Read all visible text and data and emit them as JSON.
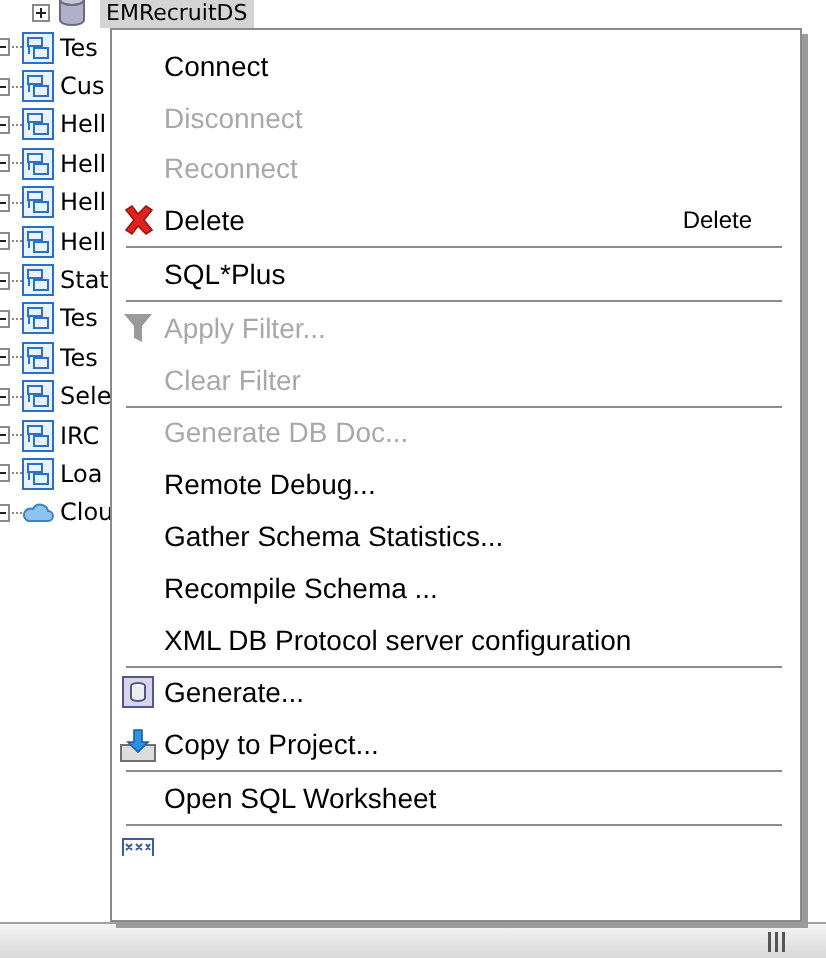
{
  "tree": {
    "root": {
      "label": "EMRecruitDS",
      "selected": true,
      "expanded": false
    },
    "items": [
      {
        "label": "Tes",
        "kind": "view"
      },
      {
        "label": "Cus",
        "kind": "view"
      },
      {
        "label": "Hell",
        "kind": "view"
      },
      {
        "label": "Hell",
        "kind": "view"
      },
      {
        "label": "Hell",
        "kind": "view"
      },
      {
        "label": "Hell",
        "kind": "view"
      },
      {
        "label": "Stat",
        "kind": "view"
      },
      {
        "label": "Tes",
        "kind": "view"
      },
      {
        "label": "Tes",
        "kind": "view"
      },
      {
        "label": "Sele",
        "kind": "view"
      },
      {
        "label": "IRC",
        "kind": "view"
      },
      {
        "label": "Loa",
        "kind": "view"
      },
      {
        "label": "Clou",
        "kind": "cloud"
      }
    ]
  },
  "context_menu": [
    {
      "kind": "item",
      "label": "Connect",
      "disabled": false
    },
    {
      "kind": "item",
      "label": "Disconnect",
      "disabled": true
    },
    {
      "kind": "item",
      "label": "Reconnect",
      "disabled": true
    },
    {
      "kind": "delete",
      "label": "Delete",
      "disabled": false,
      "shortcut": "Delete"
    },
    {
      "kind": "separator"
    },
    {
      "kind": "item",
      "label": "SQL*Plus",
      "disabled": false
    },
    {
      "kind": "separator"
    },
    {
      "kind": "filter",
      "label": "Apply Filter...",
      "disabled": true
    },
    {
      "kind": "item",
      "label": "Clear Filter",
      "disabled": true
    },
    {
      "kind": "separator"
    },
    {
      "kind": "item",
      "label": "Generate DB Doc...",
      "disabled": true
    },
    {
      "kind": "item",
      "label": "Remote Debug...",
      "disabled": false
    },
    {
      "kind": "item",
      "label": "Gather Schema Statistics...",
      "disabled": false
    },
    {
      "kind": "item",
      "label": "Recompile Schema ...",
      "disabled": false
    },
    {
      "kind": "item",
      "label": "XML DB Protocol server configuration",
      "disabled": false
    },
    {
      "kind": "separator"
    },
    {
      "kind": "generate",
      "label": "Generate...",
      "disabled": false
    },
    {
      "kind": "copy",
      "label": "Copy to Project...",
      "disabled": false
    },
    {
      "kind": "separator"
    },
    {
      "kind": "item",
      "label": "Open SQL Worksheet",
      "disabled": false
    },
    {
      "kind": "separator"
    },
    {
      "kind": "cut"
    }
  ]
}
